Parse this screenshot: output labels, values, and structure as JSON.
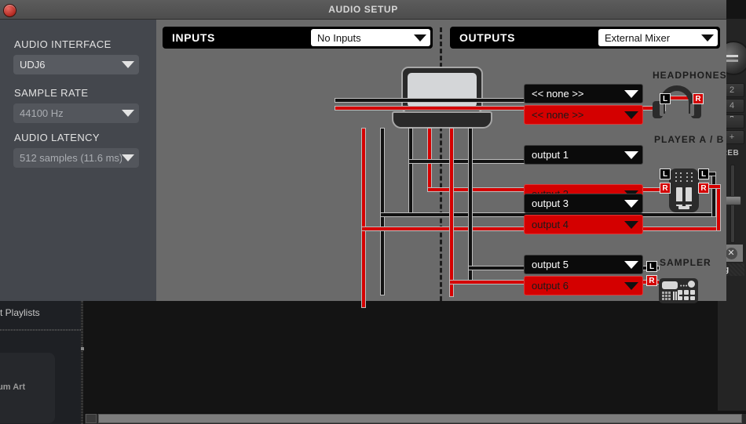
{
  "window": {
    "title": "AUDIO SETUP",
    "close_label": "close"
  },
  "sidebar": {
    "fields": [
      {
        "label": "AUDIO INTERFACE",
        "value": "UDJ6",
        "enabled": true
      },
      {
        "label": "SAMPLE RATE",
        "value": "44100 Hz",
        "enabled": false
      },
      {
        "label": "AUDIO LATENCY",
        "value": "512 samples (11.6 ms)",
        "enabled": false
      }
    ]
  },
  "inputs": {
    "title": "INPUTS",
    "selected": "No Inputs"
  },
  "outputs": {
    "title": "OUTPUTS",
    "selected": "External Mixer",
    "devices": [
      {
        "name": "HEADPHONES",
        "icon": "headphones-icon",
        "channels": [
          {
            "side": "L",
            "value": "<< none >>",
            "state": "black"
          },
          {
            "side": "R",
            "value": "<< none >>",
            "state": "red"
          }
        ]
      },
      {
        "name": "PLAYER A / B",
        "icon": "mixer-icon",
        "channels": [
          {
            "side": "L",
            "value": "output 1",
            "state": "black"
          },
          {
            "side": "R",
            "value": "output 2",
            "state": "red"
          },
          {
            "side": "L",
            "value": "output 3",
            "state": "black"
          },
          {
            "side": "R",
            "value": "output 4",
            "state": "red"
          }
        ]
      },
      {
        "name": "SAMPLER",
        "icon": "sampler-icon",
        "channels": [
          {
            "side": "L",
            "value": "output 5",
            "state": "black"
          },
          {
            "side": "R",
            "value": "output 6",
            "state": "red"
          }
        ]
      }
    ]
  },
  "background_app": {
    "playlists_label": "t Playlists",
    "album_art_label": "o Album Art",
    "deck_buttons": [
      "2",
      "4",
      "+"
    ],
    "eq_label": "TREB",
    "status_label": "ting"
  },
  "colors": {
    "accent_red": "#d40000",
    "panel_bg": "#6a6a6a",
    "sidebar_bg": "#44474d",
    "black": "#0b0b0b"
  }
}
